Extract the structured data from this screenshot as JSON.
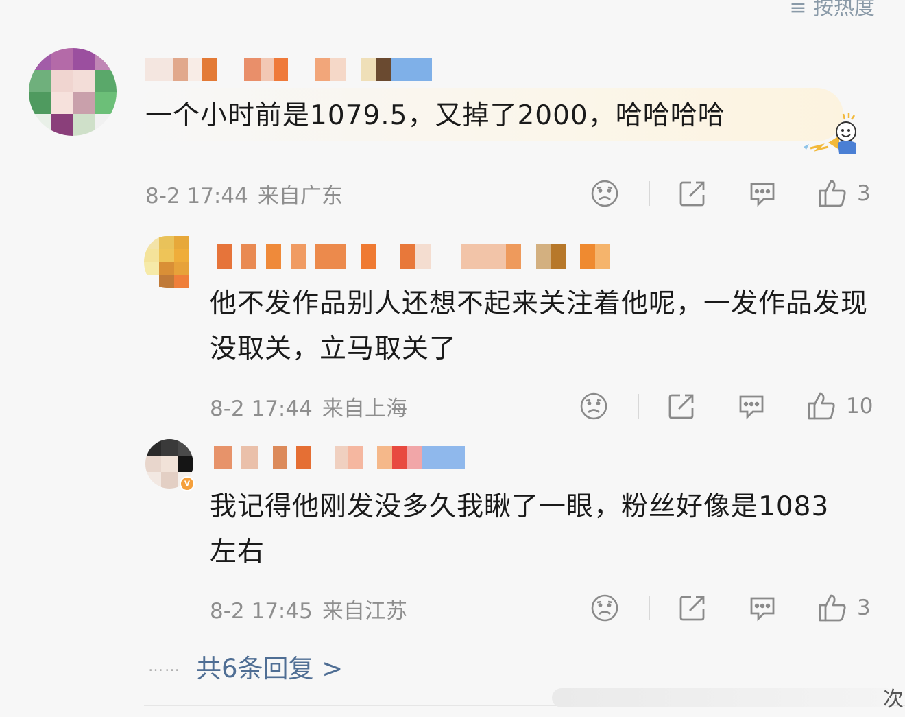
{
  "header": {
    "sort_label": "≡ 按热度"
  },
  "comments": [
    {
      "text": "一个小时前是1079.5，又掉了2000，哈哈哈哈",
      "time": "8-2 17:44",
      "location": "来自广东",
      "likes": "3"
    },
    {
      "text": "他不发作品别人还想不起来关注着他呢，一发作品发现没取关，立马取关了",
      "time": "8-2 17:44",
      "location": "来自上海",
      "likes": "10"
    },
    {
      "text": "我记得他刚发没多久我瞅了一眼，粉丝好像是1083左右",
      "time": "8-2 17:45",
      "location": "来自江苏",
      "likes": "3"
    }
  ],
  "replies": {
    "dots": "……",
    "more_label": "共6条回复 >"
  },
  "footer": {
    "edge_char": "次"
  },
  "icons": [
    "dislike-icon",
    "share-icon",
    "comment-icon",
    "like-icon",
    "verified-badge-icon"
  ],
  "colors": {
    "link": "#4f6e94",
    "meta": "#8e8e8e",
    "badge": "#f5a03c"
  }
}
